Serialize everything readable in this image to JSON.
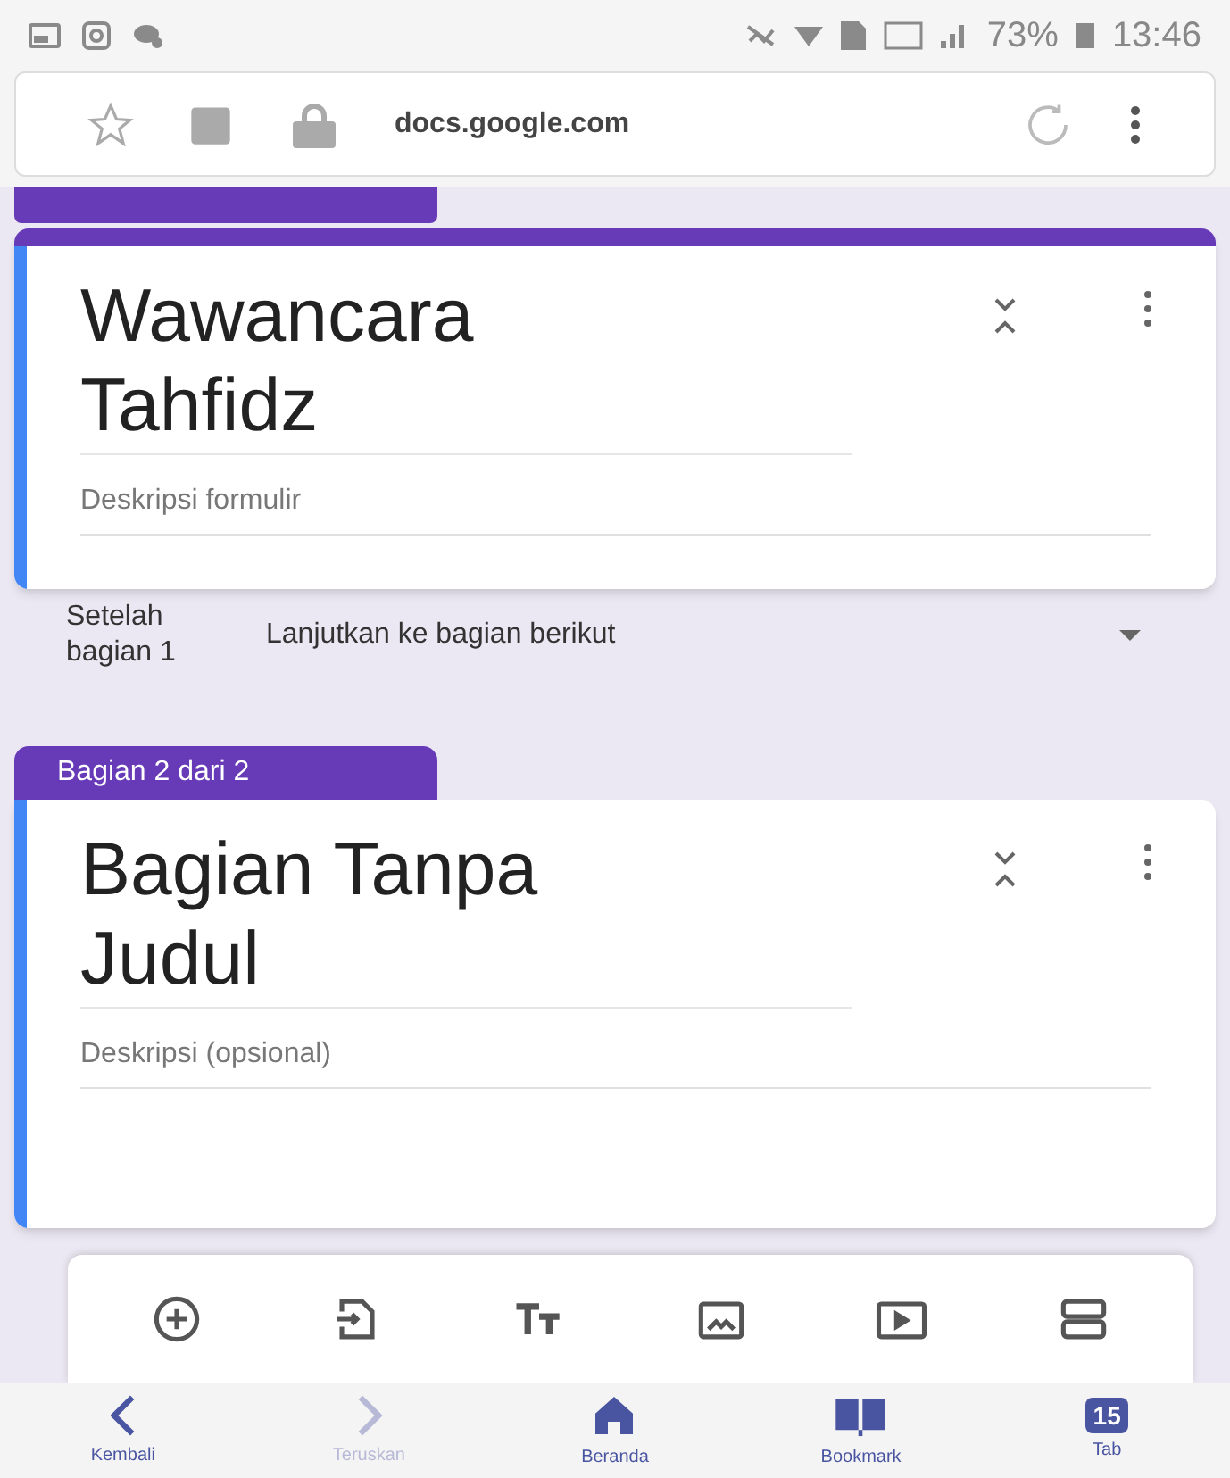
{
  "status_bar": {
    "battery": "73%",
    "time": "13:46"
  },
  "address_bar": {
    "url": "docs.google.com"
  },
  "sections": [
    {
      "title": "Wawancara Tahfidz",
      "description_placeholder": "Deskripsi formulir",
      "after": {
        "label": "Setelah bagian 1",
        "value": "Lanjutkan ke bagian berikut"
      }
    },
    {
      "tab_label": "Bagian 2 dari 2",
      "title": "Bagian Tanpa Judul",
      "description_placeholder": "Deskripsi (opsional)"
    }
  ],
  "toolbar": [
    {
      "kind": "add"
    },
    {
      "kind": "import"
    },
    {
      "kind": "text"
    },
    {
      "kind": "image"
    },
    {
      "kind": "video"
    },
    {
      "kind": "section"
    }
  ],
  "bottom_nav": [
    {
      "kind": "back",
      "label": "Kembali",
      "disabled": false
    },
    {
      "kind": "forward",
      "label": "Teruskan",
      "disabled": true
    },
    {
      "kind": "home",
      "label": "Beranda",
      "disabled": false
    },
    {
      "kind": "bookmark",
      "label": "Bookmark",
      "disabled": false
    },
    {
      "kind": "tabs",
      "label": "Tab",
      "count": "15",
      "disabled": false
    }
  ]
}
